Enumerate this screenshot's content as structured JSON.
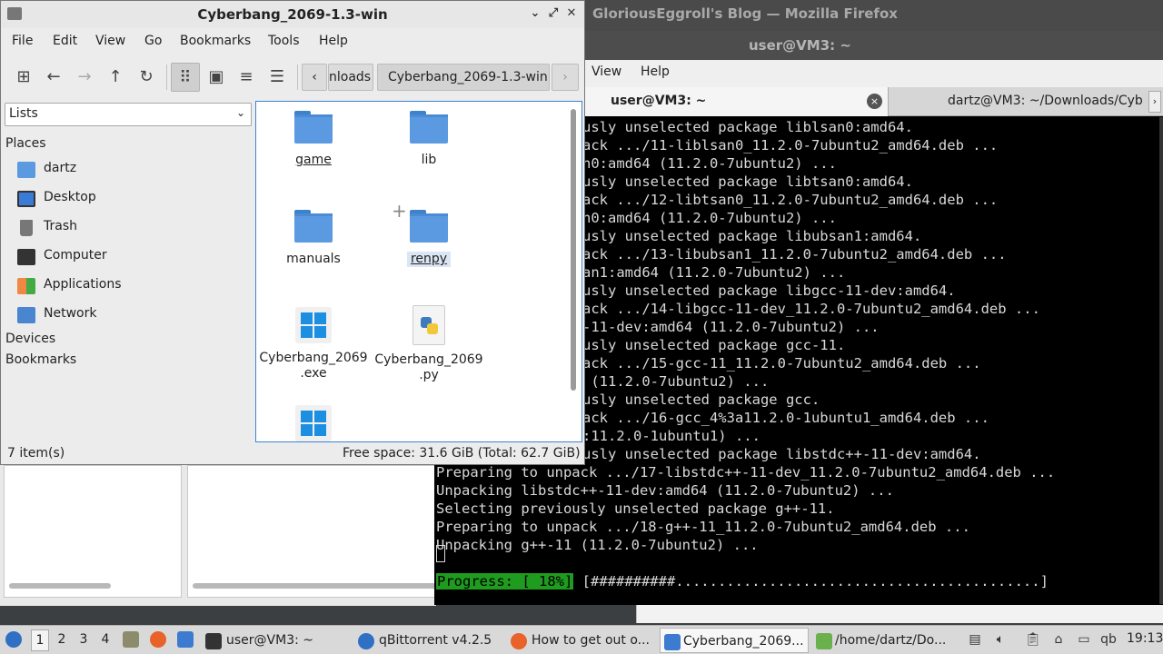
{
  "firefox": {
    "title": "GloriousEggroll's Blog — Mozilla Firefox"
  },
  "terminal": {
    "title": "user@VM3: ~",
    "menu": [
      "View",
      "Help"
    ],
    "tabs": [
      {
        "label": "user@VM3: ~",
        "close": "×"
      },
      {
        "label": "dartz@VM3: ~/Downloads/Cyb",
        "arrow": "›"
      }
    ],
    "lines": [
      "usly unselected package liblsan0:amd64.",
      "ack .../11-liblsan0_11.2.0-7ubuntu2_amd64.deb ...",
      "n0:amd64 (11.2.0-7ubuntu2) ...",
      "usly unselected package libtsan0:amd64.",
      "ack .../12-libtsan0_11.2.0-7ubuntu2_amd64.deb ...",
      "n0:amd64 (11.2.0-7ubuntu2) ...",
      "usly unselected package libubsan1:amd64.",
      "ack .../13-libubsan1_11.2.0-7ubuntu2_amd64.deb ...",
      "an1:amd64 (11.2.0-7ubuntu2) ...",
      "usly unselected package libgcc-11-dev:amd64.",
      "ack .../14-libgcc-11-dev_11.2.0-7ubuntu2_amd64.deb ...",
      "-11-dev:amd64 (11.2.0-7ubuntu2) ...",
      "usly unselected package gcc-11.",
      "ack .../15-gcc-11_11.2.0-7ubuntu2_amd64.deb ...",
      " (11.2.0-7ubuntu2) ...",
      "usly unselected package gcc.",
      "ack .../16-gcc_4%3a11.2.0-1ubuntu1_amd64.deb ...",
      ":11.2.0-1ubuntu1) ...",
      "usly unselected package libstdc++-11-dev:amd64."
    ],
    "full_lines": [
      "Preparing to unpack .../17-libstdc++-11-dev_11.2.0-7ubuntu2_amd64.deb ...",
      "Unpacking libstdc++-11-dev:amd64 (11.2.0-7ubuntu2) ...",
      "Selecting previously unselected package g++-11.",
      "Preparing to unpack .../18-g++-11_11.2.0-7ubuntu2_amd64.deb ...",
      "Unpacking g++-11 (11.2.0-7ubuntu2) ..."
    ],
    "progress_label": "Progress: [ 18%]",
    "progress_bar": "[##########...........................................]",
    "progress_fraction": 0.18
  },
  "filemanager": {
    "title": "Cyberbang_2069-1.3-win",
    "menu": [
      "File",
      "Edit",
      "View",
      "Go",
      "Bookmarks",
      "Tools",
      "Help"
    ],
    "breadcrumbs": [
      "nloads",
      "Cyberbang_2069-1.3-win"
    ],
    "crumb_prev": "‹",
    "crumb_next": "›",
    "side_pane_mode": "Lists",
    "sections": {
      "places": "Places",
      "devices": "Devices",
      "bookmarks": "Bookmarks"
    },
    "places": [
      {
        "label": "dartz",
        "icon": "home-folder-icon"
      },
      {
        "label": "Desktop",
        "icon": "desktop-icon"
      },
      {
        "label": "Trash",
        "icon": "trash-icon"
      },
      {
        "label": "Computer",
        "icon": "computer-icon"
      },
      {
        "label": "Applications",
        "icon": "applications-icon"
      },
      {
        "label": "Network",
        "icon": "network-icon"
      }
    ],
    "items": [
      {
        "name": "game",
        "type": "folder"
      },
      {
        "name": "lib",
        "type": "folder"
      },
      {
        "name": "manuals",
        "type": "folder"
      },
      {
        "name": "renpy",
        "type": "folder"
      },
      {
        "name": "Cyberbang_2069\n.exe",
        "type": "exe"
      },
      {
        "name": "Cyberbang_2069\n.py",
        "type": "python"
      },
      {
        "name": "",
        "type": "exe"
      }
    ],
    "status_left": "7 item(s)",
    "status_right": "Free space: 31.6 GiB (Total: 62.7 GiB)"
  },
  "taskbar": {
    "workspaces": [
      "1",
      "2",
      "3",
      "4"
    ],
    "tasks": [
      {
        "label": "user@VM3: ~",
        "icon": "terminal-icon"
      },
      {
        "label": "qBittorrent v4.2.5",
        "icon": "qbittorrent-icon"
      },
      {
        "label": "How to get out o...",
        "icon": "firefox-icon"
      },
      {
        "label": "Cyberbang_2069...",
        "icon": "folder-icon"
      },
      {
        "label": "/home/dartz/Do...",
        "icon": "text-editor-icon"
      }
    ],
    "tray_qb": "qb",
    "clock": "19:13"
  },
  "colors": {
    "accent": "#3c84d4",
    "folder": "#5b9ae0",
    "progress": "#1f9b1f"
  }
}
